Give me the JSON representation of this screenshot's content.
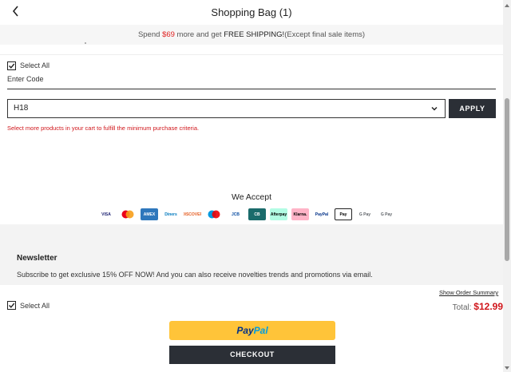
{
  "header": {
    "title": "Shopping Bag (1)"
  },
  "shipping": {
    "prefix": "Spend ",
    "amount": "$69",
    "middle": " more and get ",
    "free": "FREE SHIPPING!",
    "suffix": "(Except final sale items)"
  },
  "select_all_label": "Select All",
  "coupon": {
    "enter_code_label": "Enter Code",
    "selected_code": "H18",
    "apply_label": "APPLY",
    "error": "Select more products in your cart to fulfill the minimum purchase criteria."
  },
  "payments": {
    "title": "We Accept",
    "methods": [
      {
        "name": "visa-icon",
        "label": "VISA",
        "bg": "#ffffff",
        "fg": "#1a1f71"
      },
      {
        "name": "mastercard-icon",
        "label": "",
        "bg": "#ffffff",
        "fg": "#eb001b"
      },
      {
        "name": "amex-icon",
        "label": "AMEX",
        "bg": "#2e77bc",
        "fg": "#ffffff"
      },
      {
        "name": "diners-icon",
        "label": "Diners",
        "bg": "#ffffff",
        "fg": "#0079be"
      },
      {
        "name": "discover-icon",
        "label": "DISCOVER",
        "bg": "#ffffff",
        "fg": "#e55c20"
      },
      {
        "name": "maestro-icon",
        "label": "",
        "bg": "#ffffff",
        "fg": "#0099df"
      },
      {
        "name": "jcb-icon",
        "label": "JCB",
        "bg": "#ffffff",
        "fg": "#0b4ea2"
      },
      {
        "name": "cb-icon",
        "label": "CB",
        "bg": "#1a6b6b",
        "fg": "#ffffff"
      },
      {
        "name": "afterpay-icon",
        "label": "Afterpay",
        "bg": "#b2fce4",
        "fg": "#000000"
      },
      {
        "name": "klarna-icon",
        "label": "Klarna.",
        "bg": "#ffb3c7",
        "fg": "#000000"
      },
      {
        "name": "paypal-small-icon",
        "label": "PayPal",
        "bg": "#ffffff",
        "fg": "#003087"
      },
      {
        "name": "apple-pay-icon",
        "label": "Pay",
        "bg": "#ffffff",
        "fg": "#000000"
      },
      {
        "name": "google-pay-icon",
        "label": "G Pay",
        "bg": "#ffffff",
        "fg": "#5f6368"
      },
      {
        "name": "google-pay-icon-2",
        "label": "G Pay",
        "bg": "#ffffff",
        "fg": "#5f6368"
      }
    ]
  },
  "newsletter": {
    "title": "Newsletter",
    "text": "Subscribe to get exclusive 15% OFF NOW! And you can also receive novelties trends and promotions via email."
  },
  "summary": {
    "show_order_summary": "Show Order Summary",
    "total_label": "Total: ",
    "total_amount": "$12.99"
  },
  "actions": {
    "paypal_part1": "Pay",
    "paypal_part2": "Pal",
    "checkout_label": "CHECKOUT"
  },
  "colors": {
    "accent_red": "#d0161b",
    "dark_button": "#2b2f36",
    "paypal_yellow": "#ffc439"
  }
}
